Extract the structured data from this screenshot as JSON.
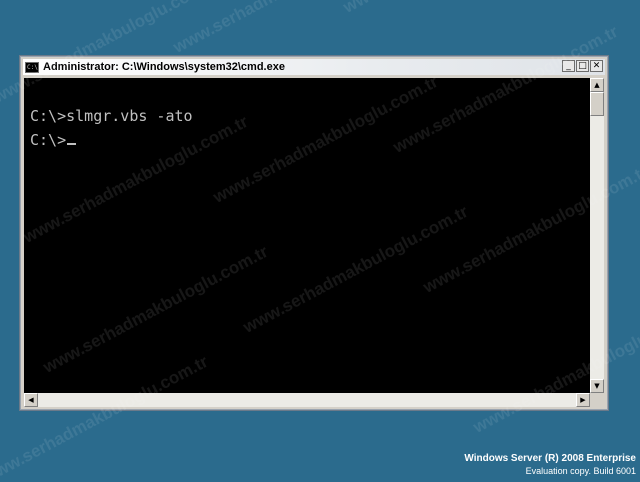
{
  "window": {
    "title": "Administrator: C:\\Windows\\system32\\cmd.exe",
    "system_icon": "C:\\",
    "buttons": {
      "minimize": "_",
      "maximize": "□",
      "close": "✕"
    }
  },
  "console": {
    "lines": [
      {
        "text": "C:\\>slmgr.vbs -ato"
      },
      {
        "text": "C:\\>",
        "has_cursor": true
      }
    ],
    "background_color": "#000000",
    "text_color": "#c0c0c0"
  },
  "scrollbars": {
    "vertical": {
      "up_arrow": "▲",
      "down_arrow": "▼"
    },
    "horizontal": {
      "left_arrow": "◀",
      "right_arrow": "▶"
    }
  },
  "branding": {
    "product": "Windows Server (R) 2008 Enterprise",
    "build": "Evaluation copy. Build 6001"
  },
  "watermark": {
    "text": "www.serhadmakbuloglu.com.tr"
  },
  "colors": {
    "desktop": "#2b6b8d",
    "window_frame": "#d4d0c8"
  }
}
